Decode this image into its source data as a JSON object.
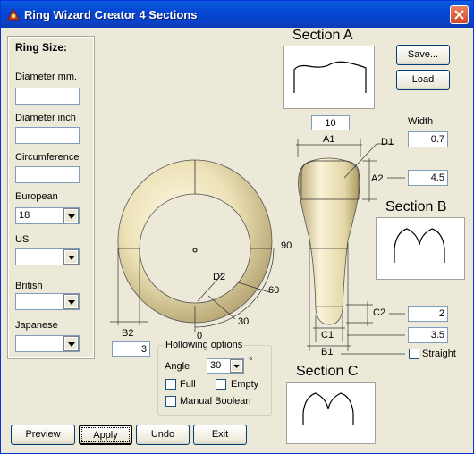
{
  "window": {
    "title": "Ring Wizard Creator 4 Sections"
  },
  "ring_size": {
    "heading": "Ring Size:",
    "diameter_mm_label": "Diameter mm.",
    "diameter_mm_value": "",
    "diameter_inch_label": "Diameter inch",
    "diameter_inch_value": "",
    "circumference_label": "Circumference",
    "circumference_value": "",
    "european_label": "European",
    "european_value": "18",
    "us_label": "US",
    "us_value": "",
    "british_label": "British",
    "british_value": "",
    "japanese_label": "Japanese",
    "japanese_value": ""
  },
  "sections": {
    "a_title": "Section A",
    "b_title": "Section B",
    "c_title": "Section C"
  },
  "file_buttons": {
    "save": "Save...",
    "load": "Load"
  },
  "dimensions": {
    "top_value": "10",
    "width_label": "Width",
    "a1_label": "A1",
    "d1_label": "D1",
    "d1_value": "0.7",
    "a2_label": "A2",
    "a2_value": "4.5",
    "c2_label": "C2",
    "c2_value": "2",
    "c1_label": "C1",
    "c1_value": "3.5",
    "b1_label": "B1",
    "straight_label": "Straight",
    "b2_label": "B2",
    "b2_value": "3",
    "d2_label": "D2",
    "angle_0": "0",
    "angle_30": "30",
    "angle_60": "60",
    "angle_90": "90"
  },
  "hollowing": {
    "title": "Hollowing options",
    "angle_label": "Angle",
    "angle_value": "30",
    "degree_symbol": "°",
    "full_label": "Full",
    "empty_label": "Empty",
    "manual_boolean_label": "Manual Boolean"
  },
  "bottom_buttons": {
    "preview": "Preview",
    "apply": "Apply",
    "undo": "Undo",
    "exit": "Exit"
  },
  "colors": {
    "titlebar": "#0a4fd8",
    "face": "#ece9d8",
    "ring": "#e8ddb0"
  },
  "icons": [
    "ring-app-icon",
    "close-icon",
    "dropdown-arrow-icon"
  ]
}
